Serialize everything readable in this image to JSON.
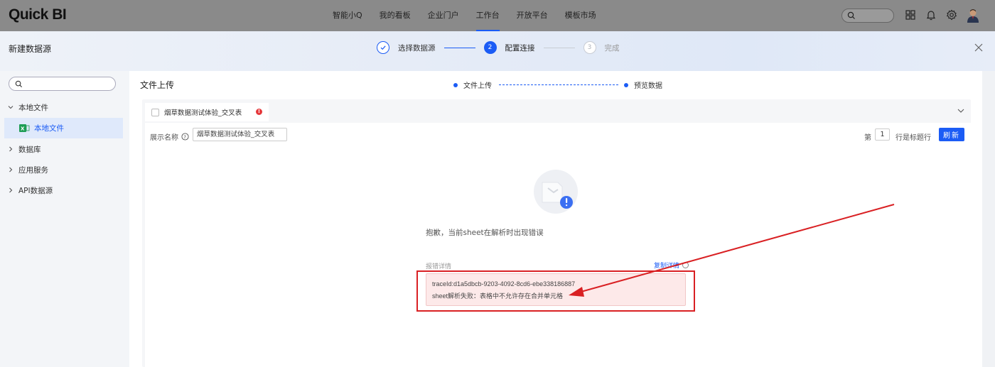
{
  "topbar": {
    "logo": "Quick BI",
    "nav": [
      "智能小Q",
      "我的看板",
      "企业门户",
      "工作台",
      "开放平台",
      "模板市场"
    ],
    "active_nav_index": 3
  },
  "modal": {
    "title": "新建数据源",
    "steps": [
      {
        "label": "选择数据源",
        "state": "done"
      },
      {
        "num": "2",
        "label": "配置连接",
        "state": "current"
      },
      {
        "num": "3",
        "label": "完成",
        "state": "todo"
      }
    ]
  },
  "sidebar": {
    "groups": [
      {
        "label": "本地文件",
        "expanded": true
      },
      {
        "label": "数据库",
        "expanded": false
      },
      {
        "label": "应用服务",
        "expanded": false
      },
      {
        "label": "API数据源",
        "expanded": false
      }
    ],
    "selected_child": "本地文件"
  },
  "panel": {
    "title": "文件上传",
    "substeps": [
      "文件上传",
      "预览数据"
    ],
    "sheet_tab": "烟草数据测试体验_交叉表",
    "display_name_label": "展示名称",
    "display_name_value": "烟草数据测试体验_交叉表",
    "header_row_prefix": "第",
    "header_row_value": "1",
    "header_row_suffix": "行是标题行",
    "refresh_label": "刷新",
    "error_message": "抱歉，当前sheet在解析时出现错误",
    "detail_label": "报错详情",
    "copy_label": "复制详情",
    "trace_line": "traceId:d1a5dbcb-9203-4092-8cd6-ebe338186887",
    "error_line": "sheet解析失败：表格中不允许存在合并单元格"
  },
  "colors": {
    "accent": "#1b5cf5",
    "error": "#e5383b",
    "annotation": "#d92023",
    "topbar": "#8a8a8a"
  },
  "icons": [
    "search-icon",
    "apps-grid-icon",
    "bell-icon",
    "gear-icon",
    "user-avatar",
    "close-icon",
    "check-icon",
    "chevron-down-icon",
    "chevron-right-icon",
    "excel-file-icon",
    "help-icon",
    "warning-icon"
  ]
}
